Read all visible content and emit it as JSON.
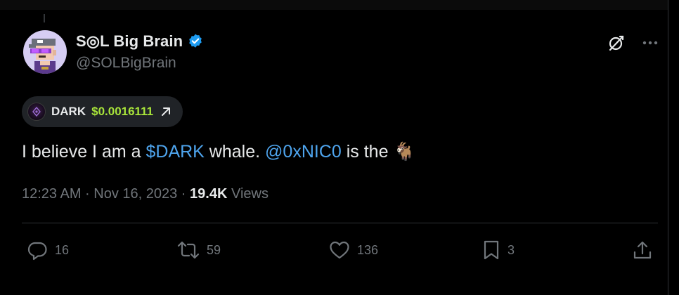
{
  "post": {
    "author_name": "S◎L Big Brain",
    "handle": "@SOLBigBrain",
    "ticker": {
      "symbol": "DARK",
      "price": "$0.0016111"
    },
    "text": {
      "part1": "I believe I am a ",
      "cashtag": "$DARK",
      "part2": " whale. ",
      "mention": "@0xNIC0",
      "part3": " is the ",
      "emoji": "🐐"
    },
    "timestamp": "12:23 AM · Nov 16, 2023",
    "separator": " · ",
    "views_count": "19.4K",
    "views_label": " Views"
  },
  "actions": {
    "replies": "16",
    "reposts": "59",
    "likes": "136",
    "bookmarks": "3"
  },
  "icons": {
    "verified": "verified-badge-icon",
    "grok": "grok-icon",
    "more": "more-icon",
    "reply": "reply-icon",
    "repost": "repost-icon",
    "like": "heart-icon",
    "bookmark": "bookmark-icon",
    "share": "share-icon"
  },
  "colors": {
    "background": "#000000",
    "text": "#e7e9ea",
    "secondary": "#71767b",
    "link": "#4ea4ed",
    "price": "#a8e43a",
    "verified": "#1d9bf0"
  }
}
